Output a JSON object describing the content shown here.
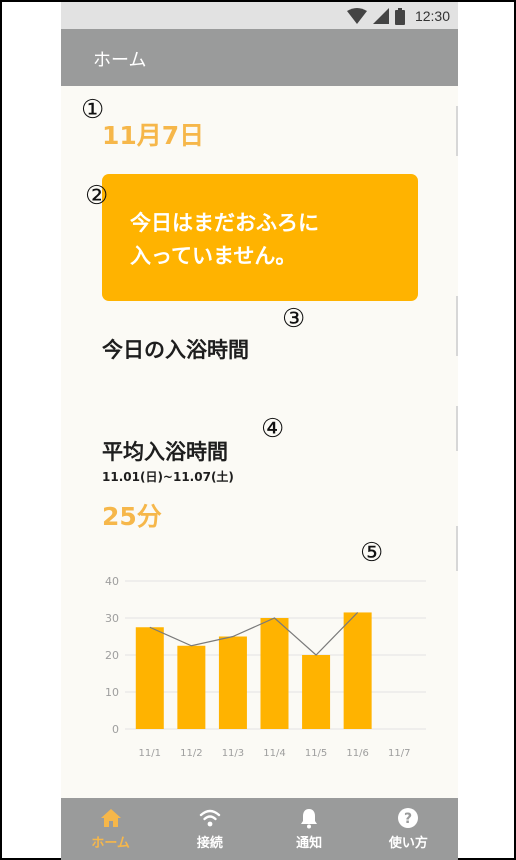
{
  "status_bar": {
    "time": "12:30"
  },
  "app_bar": {
    "title": "ホーム"
  },
  "annotations": [
    "①",
    "②",
    "③",
    "④",
    "⑤"
  ],
  "today": {
    "date": "11月7日"
  },
  "alert": {
    "message": "今日はまだおふろに\n入っていません。"
  },
  "sections": {
    "today_bath_time": "今日の入浴時間",
    "average_bath_time": "平均入浴時間",
    "period": "11.01(日)~11.07(土)",
    "average_value": "25分"
  },
  "chart_data": {
    "type": "bar",
    "categories": [
      "11/1",
      "11/2",
      "11/3",
      "11/4",
      "11/5",
      "11/6",
      "11/7"
    ],
    "series": [
      {
        "values": [
          27.5,
          22.5,
          25,
          30,
          20,
          31.5,
          null
        ]
      }
    ],
    "line_overlay": true,
    "ylim": [
      0,
      40
    ],
    "y_ticks": [
      0,
      10,
      20,
      30,
      40
    ],
    "grid": true,
    "colors": {
      "bar": "#ffb300",
      "line": "#7a7a7a",
      "grid": "#e3e3e3",
      "tick": "#9e9e9e"
    }
  },
  "bottom_nav": [
    {
      "label": "ホーム",
      "icon": "home-icon",
      "active": true
    },
    {
      "label": "接続",
      "icon": "wifi-icon",
      "active": false
    },
    {
      "label": "通知",
      "icon": "bell-icon",
      "active": false
    },
    {
      "label": "使い方",
      "icon": "help-icon",
      "active": false
    }
  ],
  "colors": {
    "accent": "#f6b74a",
    "alert": "#ffb300",
    "bar_bg": "#9a9b9b"
  }
}
